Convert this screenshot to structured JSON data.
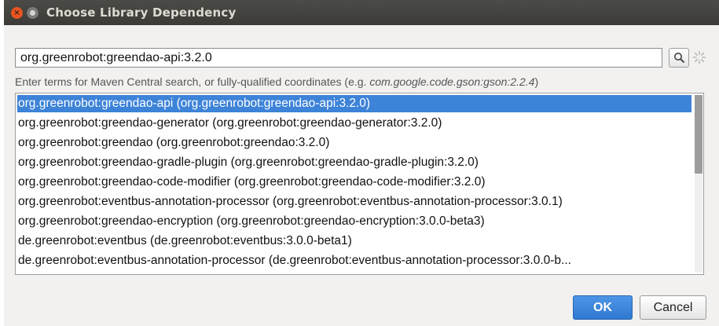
{
  "window": {
    "title": "Choose Library Dependency"
  },
  "search": {
    "value": "org.greenrobot:greendao-api:3.2.0"
  },
  "hint": {
    "prefix": "Enter terms for Maven Central search, or fully-qualified coordinates (e.g. ",
    "example": "com.google.code.gson:gson:2.2.4",
    "suffix": ")"
  },
  "results": [
    "org.greenrobot:greendao-api (org.greenrobot:greendao-api:3.2.0)",
    "org.greenrobot:greendao-generator (org.greenrobot:greendao-generator:3.2.0)",
    "org.greenrobot:greendao (org.greenrobot:greendao:3.2.0)",
    "org.greenrobot:greendao-gradle-plugin (org.greenrobot:greendao-gradle-plugin:3.2.0)",
    "org.greenrobot:greendao-code-modifier (org.greenrobot:greendao-code-modifier:3.2.0)",
    "org.greenrobot:eventbus-annotation-processor (org.greenrobot:eventbus-annotation-processor:3.0.1)",
    "org.greenrobot:greendao-encryption (org.greenrobot:greendao-encryption:3.0.0-beta3)",
    "de.greenrobot:eventbus (de.greenrobot:eventbus:3.0.0-beta1)",
    "de.greenrobot:eventbus-annotation-processor (de.greenrobot:eventbus-annotation-processor:3.0.0-b..."
  ],
  "selected_index": 0,
  "buttons": {
    "ok": "OK",
    "cancel": "Cancel"
  },
  "icons": {
    "close": "close-icon",
    "minimize": "minimize-icon",
    "search": "search-icon",
    "spinner": "spinner-icon"
  },
  "colors": {
    "titlebar": "#3c3b37",
    "selection": "#3d83d8",
    "close_button": "#e95420"
  }
}
